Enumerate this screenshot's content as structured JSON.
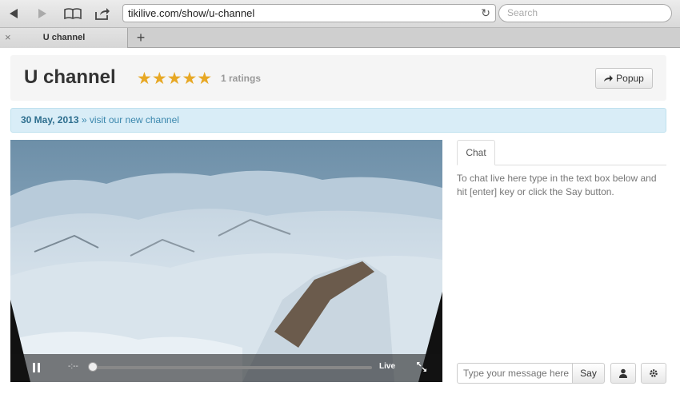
{
  "browser": {
    "url": "tikilive.com/show/u-channel",
    "search_placeholder": "Search",
    "tab_label": "U channel",
    "tab_close": "×",
    "new_tab": "+",
    "reload": "↻"
  },
  "header": {
    "title": "U channel",
    "stars": "★★★★★",
    "rating_value": 5,
    "rating_max": 5,
    "ratings_text": "1 ratings",
    "popup_label": "Popup"
  },
  "notice": {
    "date": "30 May, 2013",
    "text": " » visit our new channel"
  },
  "player": {
    "time": "-:--",
    "live_label": "Live",
    "progress_fraction": 0.0
  },
  "chat": {
    "tab_label": "Chat",
    "help_text": "To chat live here type in the text box below and hit [enter] key or click the Say button.",
    "input_placeholder": "Type your message here",
    "say_label": "Say"
  },
  "colors": {
    "star": "#e7a825",
    "notice_bg": "#d9edf7",
    "notice_text": "#3a87ad"
  }
}
